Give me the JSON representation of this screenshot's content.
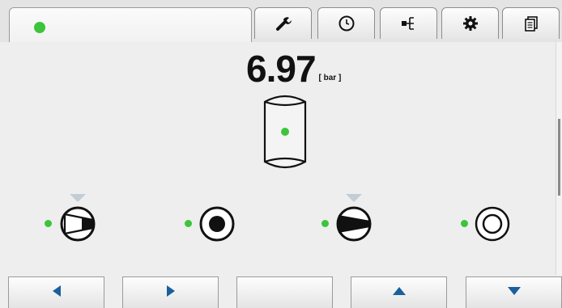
{
  "status": {
    "indicator_color": "#3cc43a",
    "indicator_icon": "status-dot"
  },
  "tabs": [
    {
      "icon": "wrench-icon"
    },
    {
      "icon": "clock-icon"
    },
    {
      "icon": "tree-icon"
    },
    {
      "icon": "gear-icon"
    },
    {
      "icon": "documents-icon"
    }
  ],
  "tank": {
    "pressure_value": "6.97",
    "pressure_unit": "[ bar ]",
    "icon": "tank-icon"
  },
  "devices": [
    {
      "icon": "compressor-icon",
      "status_color": "#3cc43a",
      "active_marker": true
    },
    {
      "icon": "filled-circle-icon",
      "status_color": "#3cc43a",
      "active_marker": false
    },
    {
      "icon": "compressor-icon",
      "status_color": "#3cc43a",
      "active_marker": true
    },
    {
      "icon": "ring-icon",
      "status_color": "#3cc43a",
      "active_marker": false
    }
  ],
  "nav_buttons": [
    {
      "icon": "arrow-left-icon"
    },
    {
      "icon": "arrow-right-icon"
    },
    {
      "icon": ""
    },
    {
      "icon": "arrow-up-icon"
    },
    {
      "icon": "arrow-down-icon"
    }
  ],
  "colors": {
    "accent": "#1a5f9e",
    "active_marker": "#c3cdd6",
    "background": "#eeeeee"
  }
}
